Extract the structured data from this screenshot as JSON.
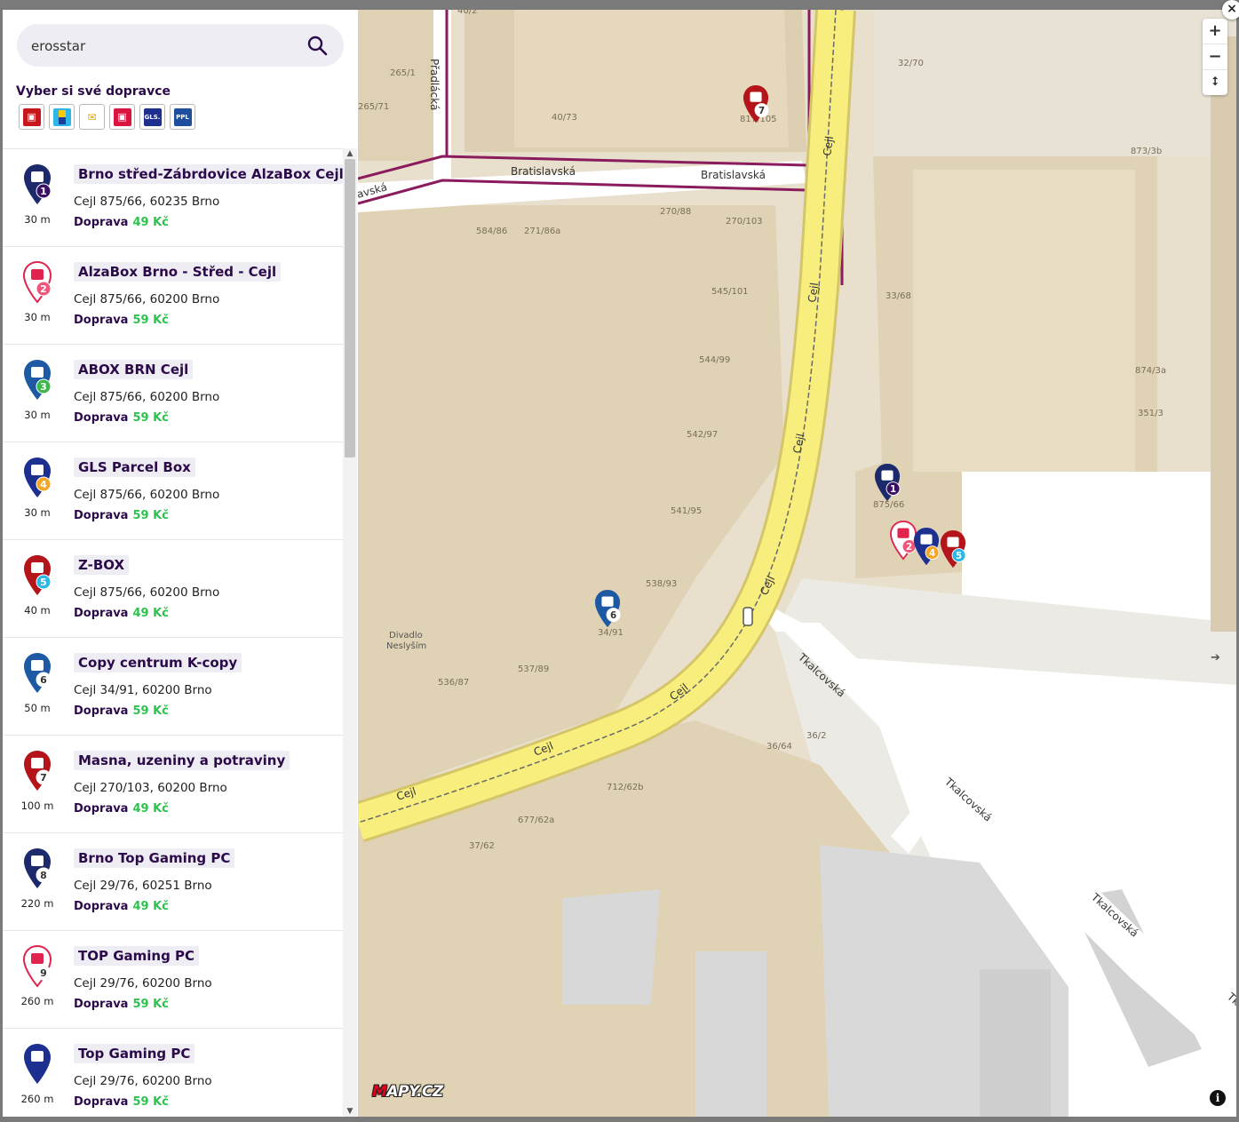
{
  "search": {
    "value": "erosstar"
  },
  "carriers_title": "Vyber si své dopravce",
  "carriers": [
    {
      "name": "Z-BOX",
      "color": "#c8161d",
      "mark": ""
    },
    {
      "name": "AlzaBox",
      "color": "#1a3e9a",
      "mark": ""
    },
    {
      "name": "Česká pošta",
      "color": "#f6c90e",
      "mark": ""
    },
    {
      "name": "Balíkovna",
      "color": "#d91540",
      "mark": ""
    },
    {
      "name": "GLS",
      "color": "#1d2f8f",
      "mark": "GLS."
    },
    {
      "name": "PPL",
      "color": "#1e4f9c",
      "mark": "PPL"
    }
  ],
  "list": [
    {
      "num": "1",
      "dist": "30 m",
      "name": "Brno střed-Zábrdovice AlzaBox Cejl",
      "addr": "Cejl 875/66, 60235 Brno",
      "fee_label": "Doprava",
      "price": "49 Kč",
      "pin_color": "#1c2a6b",
      "badge_color": "#3b1166"
    },
    {
      "num": "2",
      "dist": "30 m",
      "name": "AlzaBox Brno - Střed - Cejl",
      "addr": "Cejl 875/66, 60200 Brno",
      "fee_label": "Doprava",
      "price": "59 Kč",
      "pin_color": "#ffffff",
      "badge_color": "#f0557a"
    },
    {
      "num": "3",
      "dist": "30 m",
      "name": "ABOX BRN Cejl",
      "addr": "Cejl 875/66, 60200 Brno",
      "fee_label": "Doprava",
      "price": "59 Kč",
      "pin_color": "#1e5aa3",
      "badge_color": "#3cb84b"
    },
    {
      "num": "4",
      "dist": "30 m",
      "name": "GLS Parcel Box",
      "addr": "Cejl 875/66, 60200 Brno",
      "fee_label": "Doprava",
      "price": "59 Kč",
      "pin_color": "#1d2f8f",
      "badge_color": "#f5a623"
    },
    {
      "num": "5",
      "dist": "40 m",
      "name": "Z-BOX",
      "addr": "Cejl 875/66, 60200 Brno",
      "fee_label": "Doprava",
      "price": "49 Kč",
      "pin_color": "#b3151b",
      "badge_color": "#2bb8e8"
    },
    {
      "num": "6",
      "dist": "50 m",
      "name": "Copy centrum K-copy",
      "addr": "Cejl 34/91, 60200 Brno",
      "fee_label": "Doprava",
      "price": "59 Kč",
      "pin_color": "#1e5aa3",
      "badge_color": "#ffffff"
    },
    {
      "num": "7",
      "dist": "100 m",
      "name": "Masna, uzeniny a potraviny",
      "addr": "Cejl 270/103, 60200 Brno",
      "fee_label": "Doprava",
      "price": "49 Kč",
      "pin_color": "#b3151b",
      "badge_color": "#ffffff"
    },
    {
      "num": "8",
      "dist": "220 m",
      "name": "Brno Top Gaming PC",
      "addr": "Cejl 29/76, 60251 Brno",
      "fee_label": "Doprava",
      "price": "49 Kč",
      "pin_color": "#1c2a6b",
      "badge_color": "#ffffff"
    },
    {
      "num": "9",
      "dist": "260 m",
      "name": "TOP Gaming PC",
      "addr": "Cejl 29/76, 60200 Brno",
      "fee_label": "Doprava",
      "price": "59 Kč",
      "pin_color": "#ffffff",
      "badge_color": "#ffffff"
    },
    {
      "num": "",
      "dist": "260 m",
      "name": "Top Gaming PC",
      "addr": "Cejl 29/76, 60200 Brno",
      "fee_label": "Doprava",
      "price": "59 Kč",
      "pin_color": "#1d2f8f",
      "badge_color": ""
    }
  ],
  "map": {
    "streets": {
      "cejl": "Cejl",
      "bratislavska": "Bratislavská",
      "bratislavska_cut": "avská",
      "pradlacka": "Přadlácká",
      "tkalcovska": "Tkalcovská",
      "tkalcovska_cut": "Tk"
    },
    "poi": [
      "Divadlo",
      "Neslyším"
    ],
    "house_numbers": [
      "40/2",
      "265/1",
      "265/71",
      "40/73",
      "817/105",
      "32/70",
      "873/3b",
      "270/88",
      "270/103",
      "584/86",
      "271/86a",
      "545/101",
      "33/68",
      "544/99",
      "874/3a",
      "351/3",
      "542/97",
      "541/95",
      "875/66",
      "538/93",
      "34/91",
      "537/89",
      "536/87",
      "36/64",
      "36/2",
      "712/62b",
      "677/62a",
      "37/62"
    ],
    "markers": [
      {
        "num": "7",
        "pin_color": "#b3151b",
        "badge_color": "#ffffff"
      },
      {
        "num": "1",
        "pin_color": "#1c2a6b",
        "badge_color": "#3b1166"
      },
      {
        "num": "2",
        "pin_color": "#ffffff",
        "badge_color": "#f0557a"
      },
      {
        "num": "4",
        "pin_color": "#1d2f8f",
        "badge_color": "#f5a623"
      },
      {
        "num": "5",
        "pin_color": "#b3151b",
        "badge_color": "#2bb8e8"
      },
      {
        "num": "6",
        "pin_color": "#1e5aa3",
        "badge_color": "#ffffff"
      }
    ],
    "zoom_in": "+",
    "zoom_out": "−",
    "compass": "⭥",
    "logo_m": "M",
    "logo_rest": "APY.CZ",
    "info": "i"
  },
  "close": "×"
}
